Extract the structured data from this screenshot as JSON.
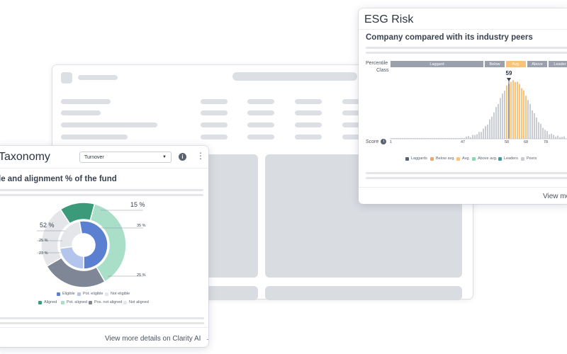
{
  "esg": {
    "title": "ESG Risk",
    "subtitle": "Company compared with its industry peers",
    "percentile_label": "Percentile",
    "class_label": "Class",
    "score_label": "Score",
    "classes": [
      "Laggard",
      "Below",
      "Avg.",
      "Above",
      "Leader"
    ],
    "highlight": "59",
    "score_ticks": [
      "1",
      "47",
      "58",
      "68",
      "78"
    ],
    "legend": [
      "Laggards",
      "Below avg.",
      "Avg.",
      "Above avg.",
      "Leaders",
      "Peers"
    ],
    "link": "View more",
    "colors": {
      "laggard": "#9aa1ac",
      "avg": "#f9c47a",
      "peers": "#c9ccd2"
    }
  },
  "taxonomy": {
    "title": "Taxonomy",
    "select_value": "Turnover",
    "subtitle": "le and alignment % of the fund",
    "pct_outer": "15 %",
    "pct_left": "52 %",
    "pct_35": "35 %",
    "pct_25a": "25 %",
    "pct_23": "23 %",
    "pct_25b": "25 %",
    "legend_row1": [
      "Eligible",
      "Pot. eligible",
      "Not eligible"
    ],
    "legend_row2": [
      "Aligned",
      "Pot. aligned",
      "Pos. not aligned",
      "Not aligned"
    ],
    "link": "View more details on Clarity AI",
    "colors": {
      "eligible": "#5b7fd1",
      "pot_eligible": "#b3c5ec",
      "not_eligible": "#e4e6ea",
      "aligned": "#3a9a7a",
      "pot_aligned": "#a9dfc8",
      "pos_not_aligned": "#7f8696"
    }
  }
}
